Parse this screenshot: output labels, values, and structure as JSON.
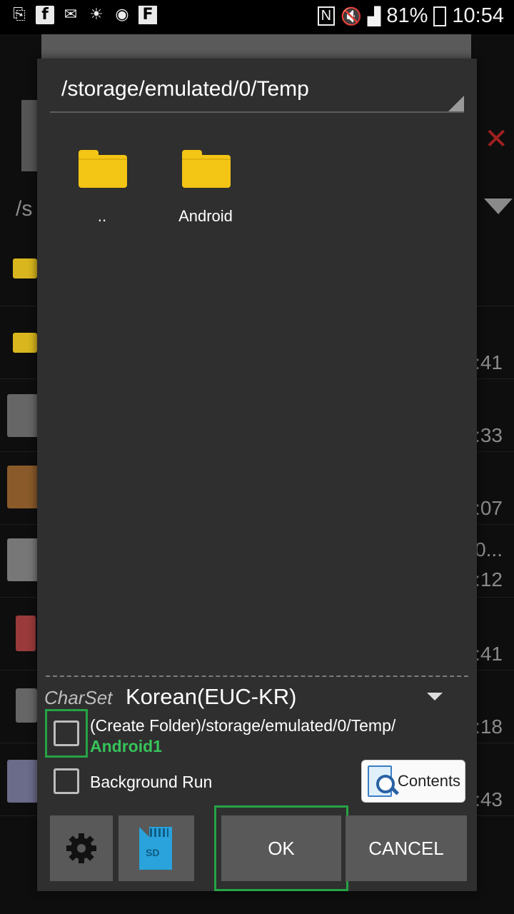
{
  "status_bar": {
    "battery": "81%",
    "time": "10:54",
    "icons_left": [
      "download-icon",
      "facebook-icon",
      "gmail-icon",
      "weather-icon",
      "app-icon",
      "flipboard-icon"
    ],
    "icons_right": [
      "nfc-icon",
      "mute-icon",
      "signal-icon",
      "battery-icon"
    ]
  },
  "background": {
    "path_fragment": "/s",
    "times": [
      ":41",
      ":33",
      ":07",
      "0...",
      ":12",
      ":41",
      ":18",
      ":43"
    ]
  },
  "dialog": {
    "path": "/storage/emulated/0/Temp",
    "folders": [
      {
        "label": ".."
      },
      {
        "label": "Android"
      }
    ],
    "charset_label": "CharSet",
    "charset_value": "Korean(EUC-KR)",
    "create_folder_text": "(Create Folder)/storage/emulated/0/Temp/",
    "create_folder_name": "Android1",
    "background_run_label": "Background Run",
    "contents_label": "Contents",
    "ok_label": "OK",
    "cancel_label": "CANCEL",
    "sd_label": "SD",
    "accent_color": "#25a445"
  }
}
